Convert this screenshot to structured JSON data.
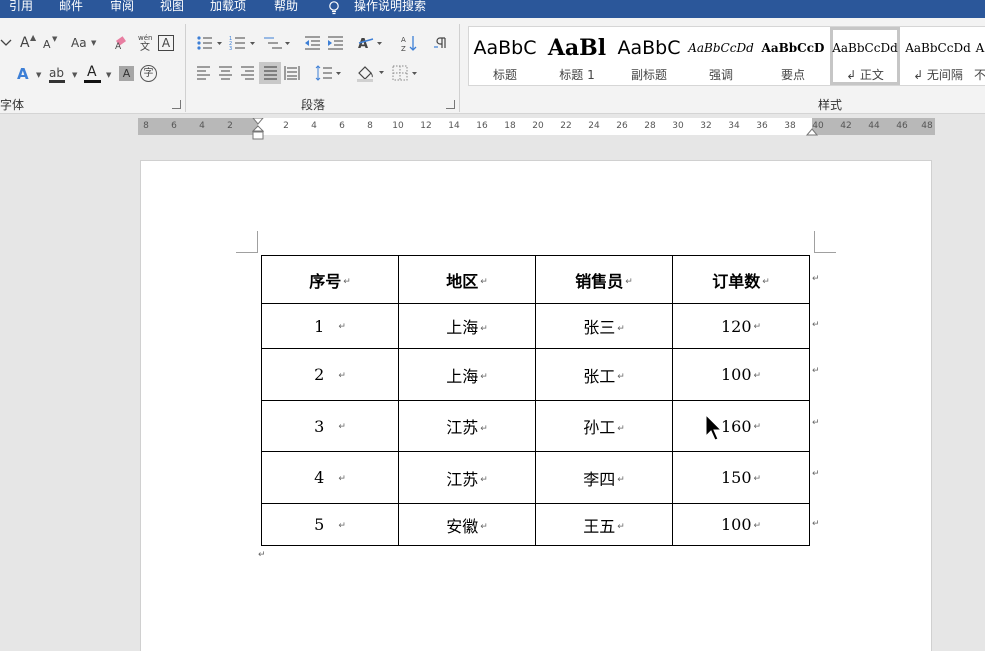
{
  "menu": {
    "tabs": [
      "引用",
      "邮件",
      "审阅",
      "视图",
      "加载项",
      "帮助"
    ],
    "tell_me": "操作说明搜索"
  },
  "ribbon": {
    "font_group_label": "字体",
    "paragraph_group_label": "段落",
    "styles_group_label": "样式",
    "font_buttons": {
      "grow": "A",
      "shrink": "A",
      "change_case": "Aa",
      "phonetic_top": "wén",
      "phonetic_bottom": "文",
      "border": "A",
      "effects": "A",
      "highlight": "ab",
      "color": "A",
      "shading": "A",
      "enclose": "字"
    },
    "styles": [
      {
        "sample": "AaBbC",
        "name": "标题"
      },
      {
        "sample": "AaBl",
        "name": "标题 1"
      },
      {
        "sample": "AaBbC",
        "name": "副标题"
      },
      {
        "sample": "AaBbCcDd",
        "name": "强调"
      },
      {
        "sample": "AaBbCcD",
        "name": "要点"
      },
      {
        "sample": "AaBbCcDd",
        "name": "↲ 正文"
      },
      {
        "sample": "AaBbCcDd",
        "name": "↲ 无间隔"
      },
      {
        "sample": "A",
        "name": "不"
      }
    ]
  },
  "ruler": {
    "left_numbers": [
      "8",
      "6",
      "4",
      "2"
    ],
    "numbers": [
      "2",
      "4",
      "6",
      "8",
      "10",
      "12",
      "14",
      "16",
      "18",
      "20",
      "22",
      "24",
      "26",
      "28",
      "30",
      "32",
      "34",
      "36",
      "38",
      "40",
      "42",
      "44",
      "46",
      "48"
    ]
  },
  "document": {
    "headers": [
      "序号",
      "地区",
      "销售员",
      "订单数"
    ],
    "rows": [
      [
        "1",
        "上海",
        "张三",
        "120"
      ],
      [
        "2",
        "上海",
        "张工",
        "100"
      ],
      [
        "3",
        "江苏",
        "孙工",
        "160"
      ],
      [
        "4",
        "江苏",
        "李四",
        "150"
      ],
      [
        "5",
        "安徽",
        "王五",
        "100"
      ]
    ],
    "paragraph_mark": "↵"
  }
}
